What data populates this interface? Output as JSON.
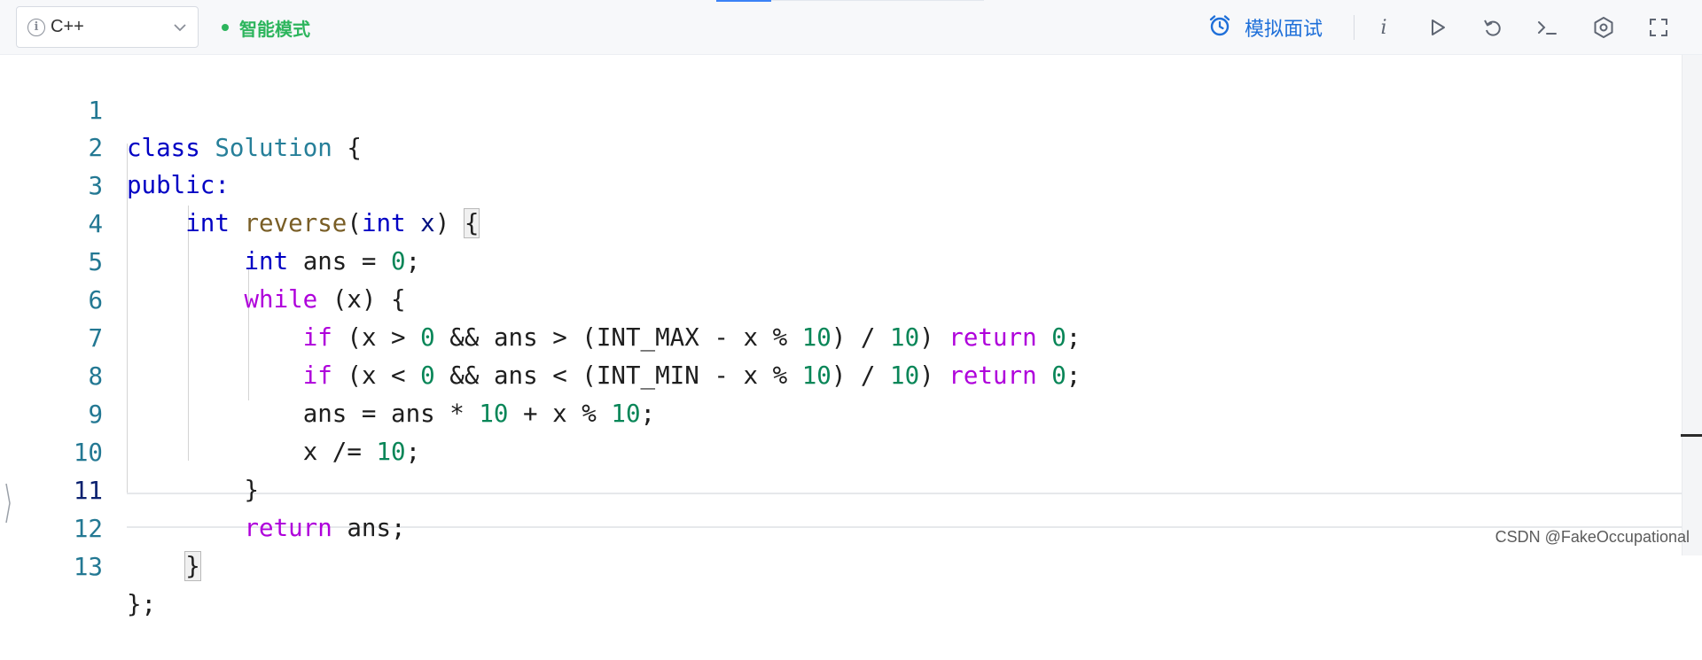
{
  "toolbar": {
    "language": "C++",
    "mode_label": "智能模式",
    "interview_label": "模拟面试",
    "info_icon_glyph": "i",
    "note_glyph": "i",
    "accent_color": "#1e6fd9",
    "mode_color": "#2db55d"
  },
  "editor": {
    "active_line": "11",
    "lines": [
      {
        "n": "1",
        "tokens": [
          [
            "kw",
            "class"
          ],
          [
            "",
            ""
          ],
          [
            "ty",
            "Solution"
          ],
          [
            "",
            ""
          ],
          [
            "",
            "{"
          ]
        ]
      },
      {
        "n": "2",
        "tokens": [
          [
            "kw",
            "public:"
          ]
        ]
      },
      {
        "n": "3",
        "tokens": [
          [
            "kw",
            "int"
          ],
          [
            "fn",
            "reverse"
          ],
          [
            "",
            "("
          ],
          [
            "kw",
            "int"
          ],
          [
            "va",
            "x"
          ],
          [
            "",
            ")"
          ],
          [
            "",
            "{"
          ]
        ]
      },
      {
        "n": "4",
        "tokens": [
          [
            "kw",
            "int"
          ],
          [
            "va",
            "ans"
          ],
          [
            "",
            "="
          ],
          [
            "nm",
            "0"
          ],
          [
            "",
            ";"
          ]
        ]
      },
      {
        "n": "5",
        "tokens": [
          [
            "kw2",
            "while"
          ],
          [
            "",
            "(x)"
          ],
          [
            "",
            "{"
          ]
        ]
      },
      {
        "n": "6",
        "text": "if (x > 0 && ans > (INT_MAX - x % 10) / 10) return 0;"
      },
      {
        "n": "7",
        "text": "if (x < 0 && ans < (INT_MIN - x % 10) / 10) return 0;"
      },
      {
        "n": "8",
        "text": "ans = ans * 10 + x % 10;"
      },
      {
        "n": "9",
        "text": "x /= 10;"
      },
      {
        "n": "10",
        "text": "}"
      },
      {
        "n": "11",
        "text": "return ans;"
      },
      {
        "n": "12",
        "text": "}"
      },
      {
        "n": "13",
        "text": "};"
      }
    ]
  },
  "watermark": "CSDN @FakeOccupational"
}
